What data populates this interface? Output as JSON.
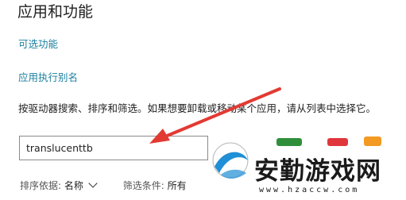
{
  "page": {
    "title": "应用和功能",
    "optional_features_link": "可选功能",
    "app_alias_link": "应用执行别名",
    "description": "按驱动器搜索、排序和筛选。如果想要卸载或移动某个应用，请从列表中选择它。"
  },
  "search": {
    "value": "translucenttb"
  },
  "sort": {
    "label": "排序依据:",
    "value": "名称"
  },
  "filter": {
    "label": "筛选条件:",
    "value": "所有"
  },
  "watermark": {
    "text": "安勤游戏网",
    "url": "www.hzaccw.com",
    "colors": {
      "swoosh": "#1f8fd6",
      "green": "#2f8f3a",
      "red": "#e0363b",
      "orange": "#f29a22"
    }
  },
  "annotation": {
    "arrow_color": "#e23a33"
  }
}
